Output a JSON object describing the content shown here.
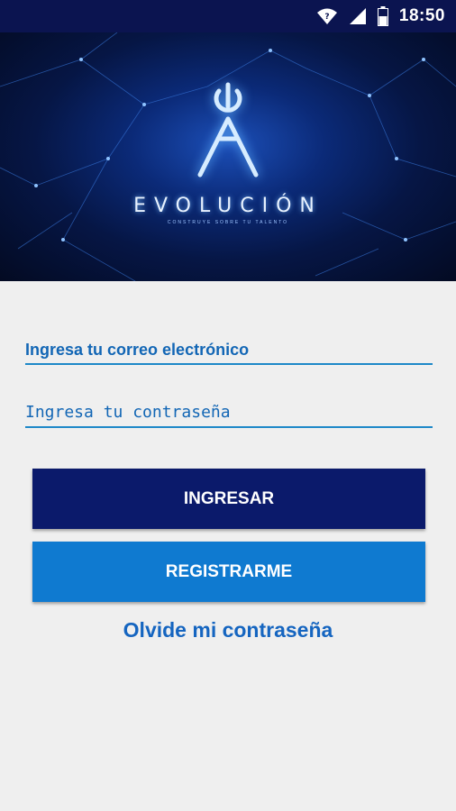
{
  "status_bar": {
    "time": "18:50",
    "icons": [
      "wifi-icon",
      "signal-icon",
      "battery-icon"
    ]
  },
  "hero": {
    "brand": "EVOLUCIÓN",
    "subtitle": "CONSTRUYE SOBRE TU TALENTO"
  },
  "form": {
    "email_placeholder": "Ingresa tu correo electrónico",
    "password_placeholder": "Ingresa tu contraseña"
  },
  "buttons": {
    "login": "INGRESAR",
    "register": "REGISTRARME"
  },
  "forgot_password": "Olvide mi contraseña",
  "colors": {
    "status_bar": "#0b1450",
    "primary_dark": "#0b1a6b",
    "primary": "#0f7ad0",
    "link": "#1565c0",
    "field_underline": "#1e88c8",
    "background": "#efefef"
  }
}
